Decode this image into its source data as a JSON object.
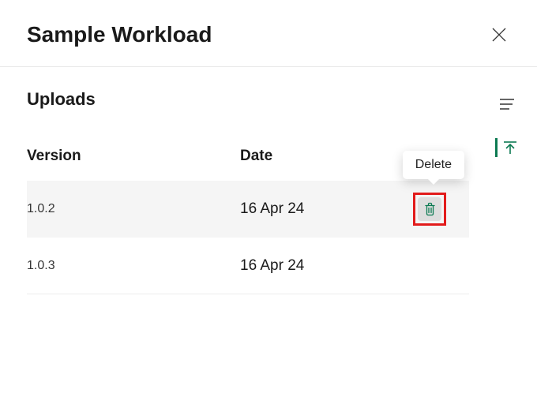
{
  "header": {
    "title": "Sample Workload"
  },
  "section": {
    "title": "Uploads"
  },
  "table": {
    "columns": {
      "version": "Version",
      "date": "Date"
    },
    "rows": [
      {
        "version": "1.0.2",
        "date": "16 Apr 24",
        "highlighted": true,
        "showDelete": true
      },
      {
        "version": "1.0.3",
        "date": "16 Apr 24",
        "highlighted": false,
        "showDelete": false
      }
    ]
  },
  "tooltip": {
    "delete": "Delete"
  },
  "colors": {
    "accent": "#0c7a52",
    "annotation": "#e21b1b"
  }
}
